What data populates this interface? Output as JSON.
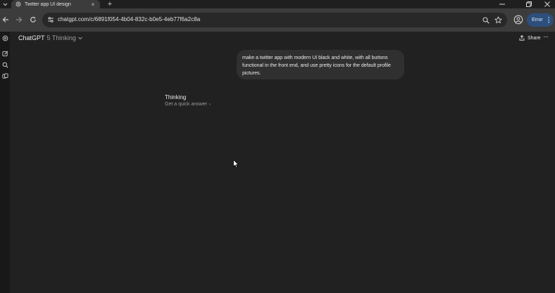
{
  "browser": {
    "tab": {
      "title": "Twitter app UI design",
      "favicon": "chatgpt-logo-icon"
    },
    "new_tab_label": "+",
    "url": "chatgpt.com/c/6891f054-4b04-832c-b0e5-4eb77f6a2c8a",
    "error_label": "Error"
  },
  "app": {
    "name": "ChatGPT",
    "model": "5 Thinking",
    "share_label": "Share"
  },
  "conversation": {
    "user_message": "make a twitter app with modern UI black and white, with all buttons functional in the front end, and use pretty icons for the default profile pictures.",
    "status": "Thinking",
    "quick_answer_label": "Get a quick answer"
  },
  "colors": {
    "page_bg": "#212121",
    "chrome_bar": "#3c3c3c",
    "bubble_bg": "#303030",
    "error_button": "#2c4f7c"
  }
}
